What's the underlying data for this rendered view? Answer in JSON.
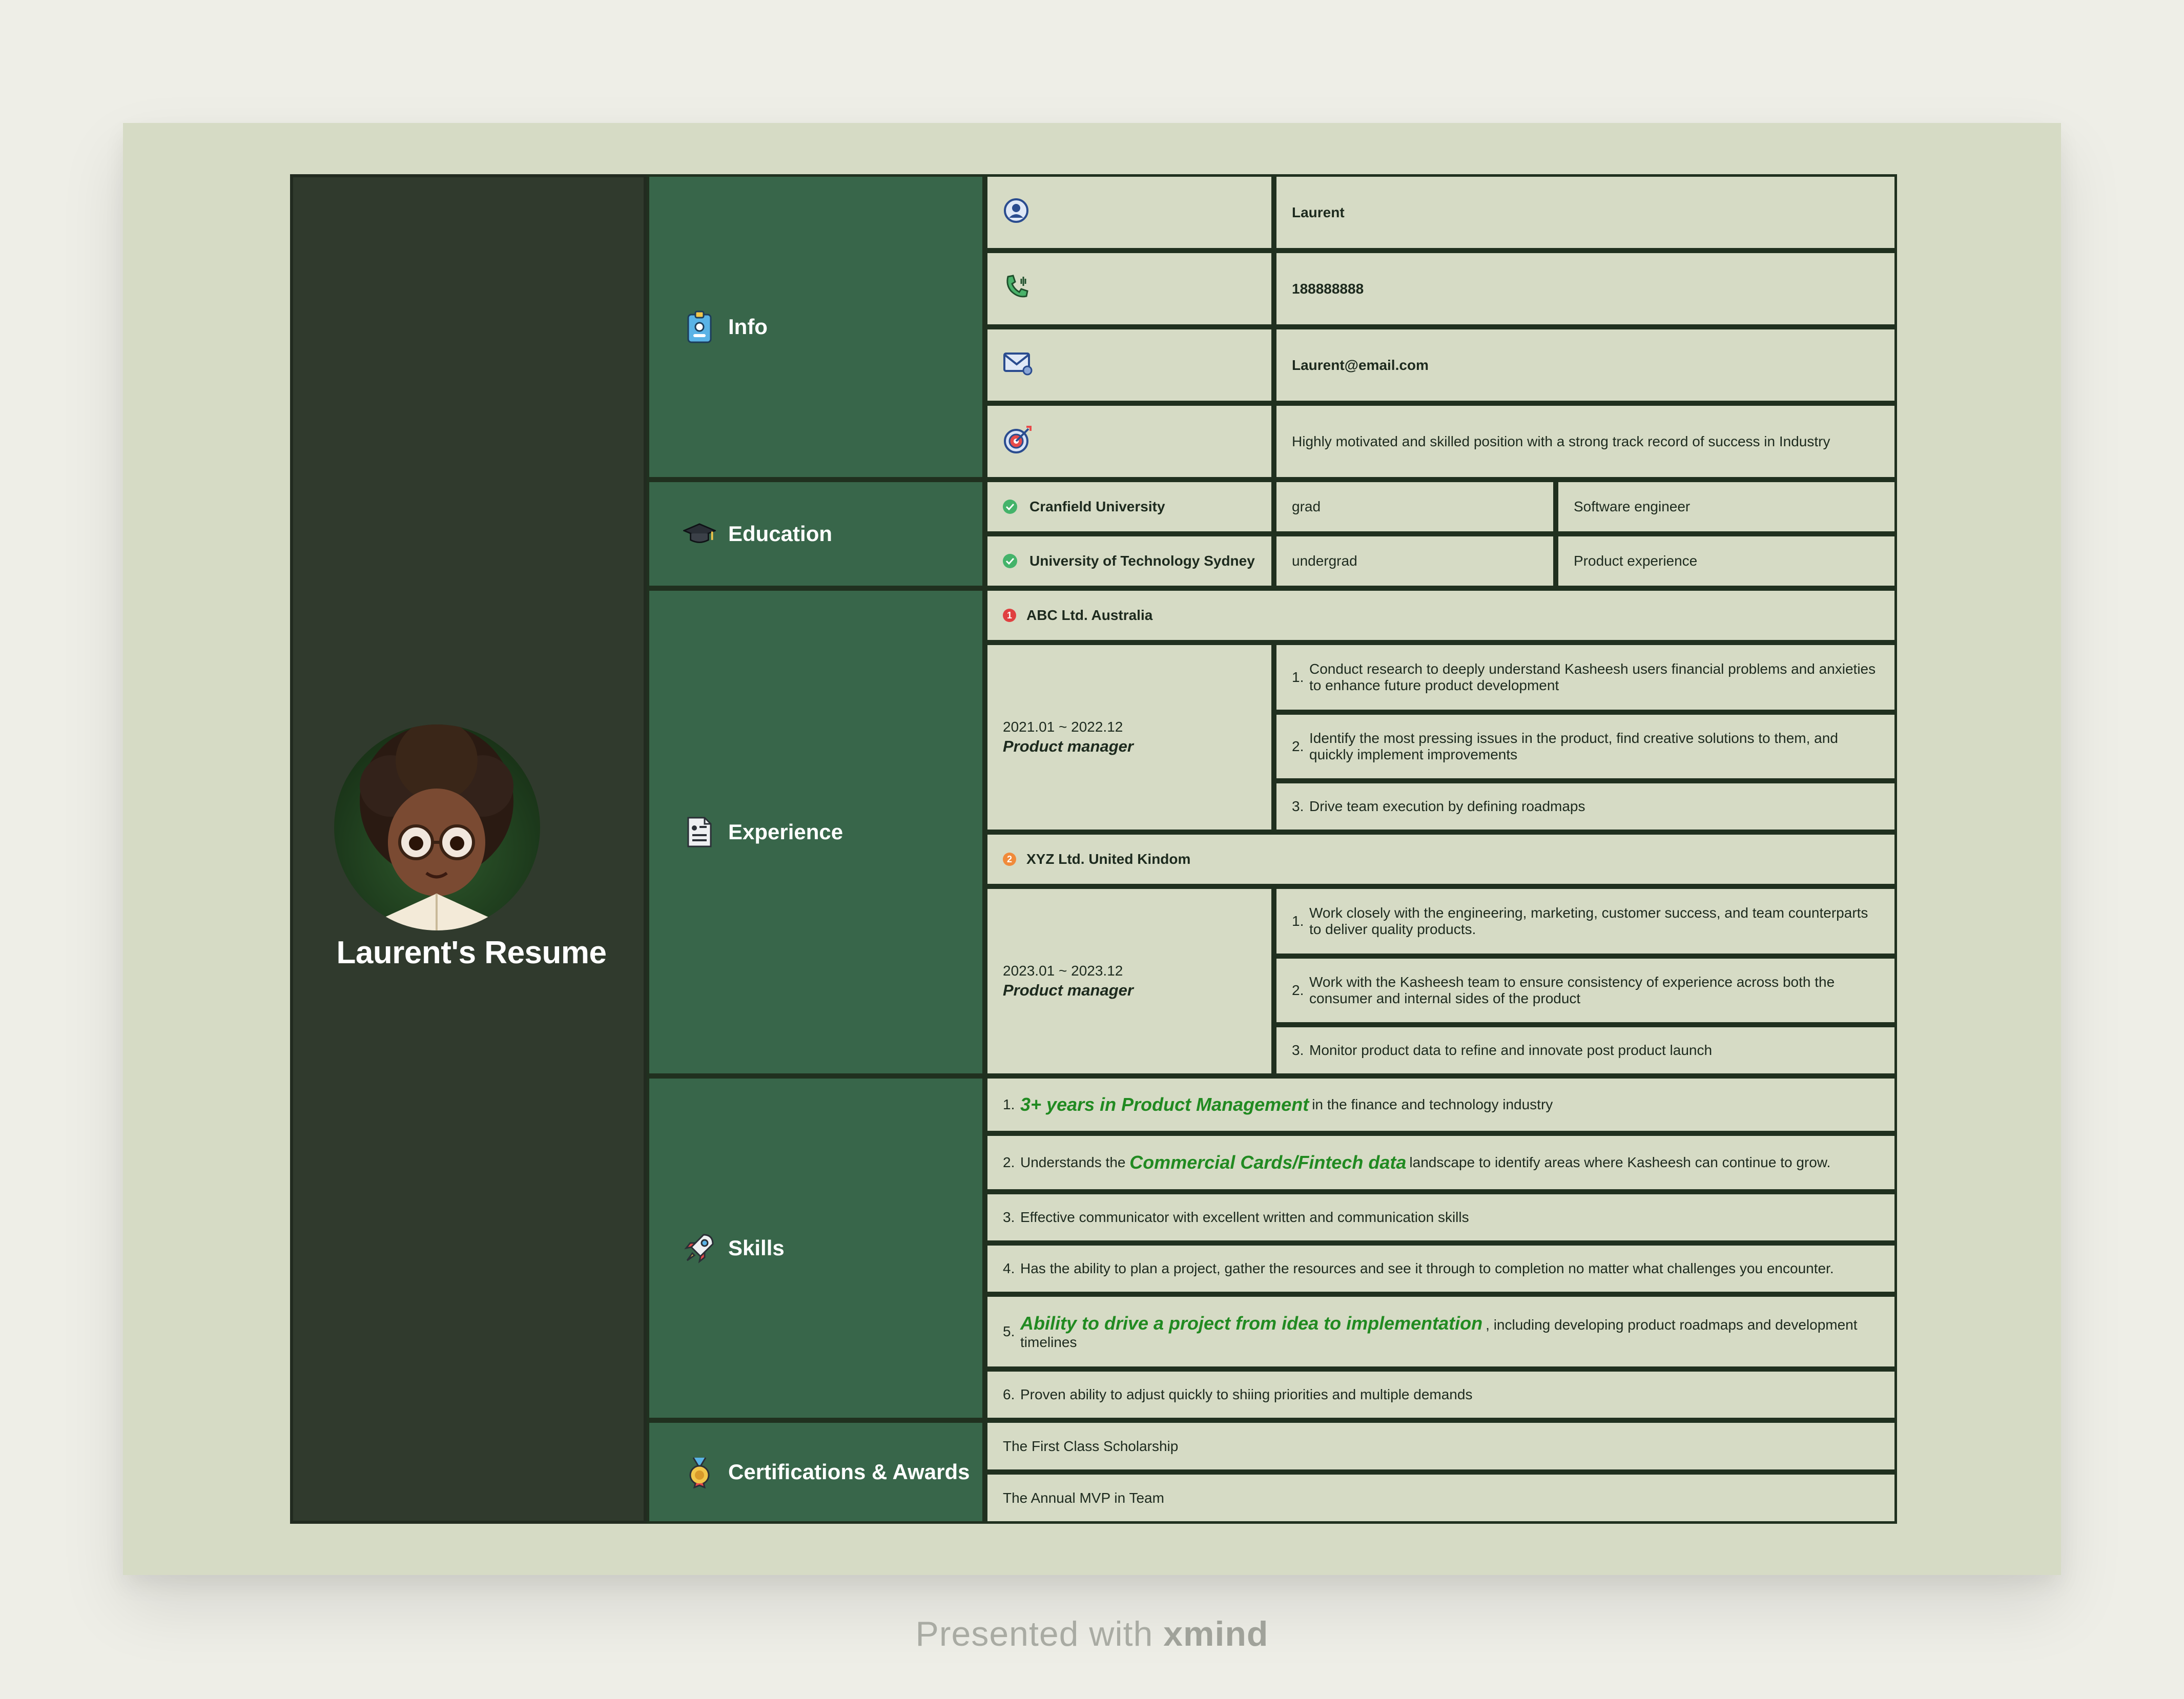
{
  "title": "Laurent's Resume",
  "categories": {
    "info": "Info",
    "education": "Education",
    "experience": "Experience",
    "skills": "Skills",
    "certs": "Certifications & Awards"
  },
  "info": {
    "name": "Laurent",
    "phone": "188888888",
    "email": "Laurent@email.com",
    "objective": "Highly motivated and skilled position with a strong track record of success in Industry"
  },
  "education": [
    {
      "school": "Cranfield University",
      "level": "grad",
      "field": "Software engineer"
    },
    {
      "school": "University of Technology Sydney",
      "level": "undergrad",
      "field": "Product experience"
    }
  ],
  "experience": [
    {
      "index": "1",
      "company": "ABC Ltd. Australia",
      "dates": "2021.01 ~ 2022.12",
      "role": "Product manager",
      "duties": [
        {
          "n": "1.",
          "text": "Conduct research to deeply understand Kasheesh users financial problems and anxieties to enhance future product development"
        },
        {
          "n": "2.",
          "text": "Identify the most pressing issues in the product, find creative solutions to them, and quickly implement improvements"
        },
        {
          "n": "3.",
          "text": "Drive team execution by defining roadmaps"
        }
      ]
    },
    {
      "index": "2",
      "company": "XYZ Ltd. United Kindom",
      "dates": "2023.01 ~ 2023.12",
      "role": "Product manager",
      "duties": [
        {
          "n": "1.",
          "text": "Work closely with the engineering, marketing, customer success, and team counterparts to deliver quality products."
        },
        {
          "n": "2.",
          "text": "Work with the Kasheesh team to ensure consistency of experience across both the consumer and internal sides of the product"
        },
        {
          "n": "3.",
          "text": "Monitor product data to refine and innovate post product launch"
        }
      ]
    }
  ],
  "skills": [
    {
      "n": "1.",
      "pre": "",
      "hl": "3+ years in Product Management",
      "post": "in the finance and technology industry"
    },
    {
      "n": "2.",
      "pre": "Understands the ",
      "hl": "Commercial Cards/Fintech data",
      "post": "landscape to identify areas where Kasheesh can continue to grow."
    },
    {
      "n": "3.",
      "pre": "Effective communicator with excellent written and communication skills",
      "hl": "",
      "post": ""
    },
    {
      "n": "4.",
      "pre": "Has the ability to plan a project, gather the resources and see it through to completion no matter what challenges you encounter.",
      "hl": "",
      "post": ""
    },
    {
      "n": "5.",
      "pre": "",
      "hl": "Ability to drive a project from idea to implementation",
      "post": ", including developing product roadmaps and development timelines"
    },
    {
      "n": "6.",
      "pre": "Proven ability to adjust quickly to shiing priorities and multiple demands",
      "hl": "",
      "post": ""
    }
  ],
  "certs": [
    "The First Class Scholarship",
    "The Annual MVP in Team"
  ],
  "footer": {
    "pre": "Presented with ",
    "brand": "xmind"
  },
  "colors": {
    "sidebar": "#303a2d",
    "category": "#38664a",
    "cell": "#d6dbc5",
    "highlight": "#218a21",
    "badge1": "#e04040",
    "badge2": "#f08a3a",
    "check": "#44b36a"
  },
  "icons": [
    "badge-id-icon",
    "graduation-cap-icon",
    "document-icon",
    "rocket-icon",
    "medal-icon",
    "person-icon",
    "phone-icon",
    "mail-icon",
    "target-icon",
    "check-icon"
  ]
}
